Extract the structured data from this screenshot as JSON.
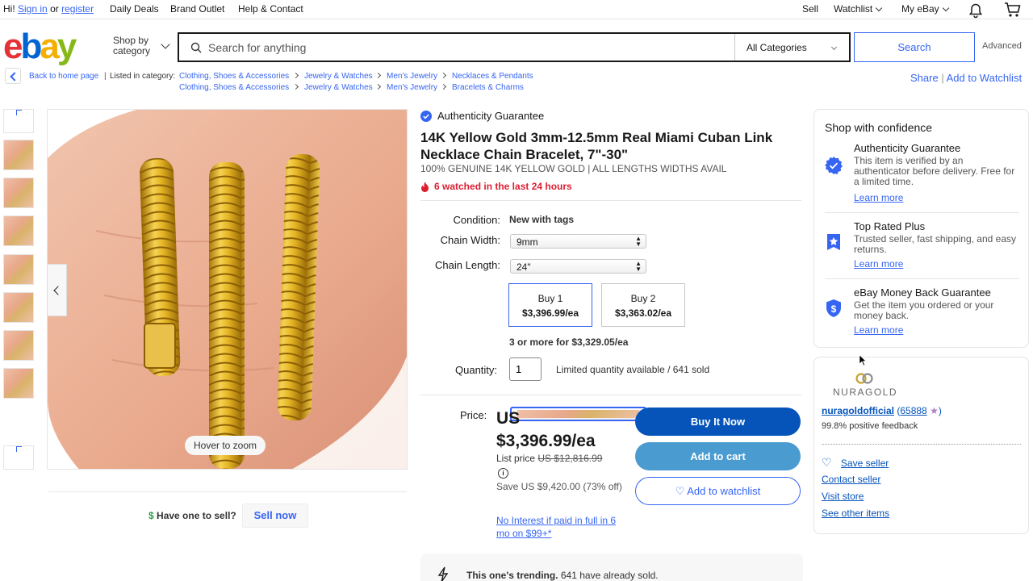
{
  "topbar": {
    "greeting": "Hi!",
    "signin": "Sign in",
    "or": "or",
    "register": "register",
    "daily_deals": "Daily Deals",
    "brand_outlet": "Brand Outlet",
    "help": "Help & Contact",
    "sell": "Sell",
    "watchlist": "Watchlist",
    "my_ebay": "My eBay",
    "bell_icon": "bell-icon",
    "cart_icon": "cart-icon"
  },
  "header": {
    "logo": [
      "e",
      "b",
      "a",
      "y"
    ],
    "shop_by_line1": "Shop by",
    "shop_by_line2": "category",
    "search_placeholder": "Search for anything",
    "category": "All Categories",
    "search_button": "Search",
    "advanced": "Advanced"
  },
  "breadcrumbs": {
    "back": "Back to home page",
    "listed_in": "Listed in category:",
    "row1": [
      "Clothing, Shoes & Accessories",
      "Jewelry & Watches",
      "Men's Jewelry",
      "Necklaces & Pendants"
    ],
    "row2": [
      "Clothing, Shoes & Accessories",
      "Jewelry & Watches",
      "Men's Jewelry",
      "Bracelets & Charms"
    ],
    "share": "Share",
    "add_to_watchlist": "Add to Watchlist"
  },
  "gallery": {
    "hover_to_zoom": "Hover to zoom",
    "thumb_count": 8,
    "selected_thumb": 8,
    "have_one": "Have one to sell?",
    "sell_now": "Sell now"
  },
  "listing": {
    "authenticity": "Authenticity Guarantee",
    "title": "14K Yellow Gold 3mm-12.5mm Real Miami Cuban Link Necklace Chain Bracelet, 7\"-30\"",
    "subtitle": "100% GENUINE 14K YELLOW GOLD | ALL LENGTHS WIDTHS AVAIL",
    "watched": "6 watched in the last 24 hours",
    "condition_label": "Condition:",
    "condition_value": "New with tags",
    "width_label": "Chain Width:",
    "width_value": "9mm",
    "length_label": "Chain Length:",
    "length_value": "24\"",
    "buy1_label": "Buy 1",
    "buy1_price": "$3,396.99/ea",
    "buy2_label": "Buy 2",
    "buy2_price": "$3,363.02/ea",
    "bulk": "3 or more for $3,329.05/ea",
    "quantity_label": "Quantity:",
    "quantity_value": "1",
    "availability": "Limited quantity available / 641 sold",
    "price_label": "Price:",
    "price_line1": "US",
    "price_line2": "$3,396.99/ea",
    "list_price_label": "List price",
    "list_price_value": "US $12,816.99",
    "save": "Save US $9,420.00 (73% off)",
    "no_interest": "No Interest if paid in full in 6 mo on $99+*",
    "buy_now": "Buy It Now",
    "add_to_cart": "Add to cart",
    "add_to_watchlist": "Add to watchlist",
    "trending_bold": "This one's trending.",
    "trending_rest": "641 have already sold."
  },
  "confidence": {
    "title": "Shop with confidence",
    "items": [
      {
        "title": "Authenticity Guarantee",
        "desc": "This item is verified by an authenticator before delivery. Free for a limited time.",
        "link": "Learn more"
      },
      {
        "title": "Top Rated Plus",
        "desc": "Trusted seller, fast shipping, and easy returns.",
        "link": "Learn more"
      },
      {
        "title": "eBay Money Back Guarantee",
        "desc": "Get the item you ordered or your money back.",
        "link": "Learn more"
      }
    ]
  },
  "seller": {
    "logo_text": "NURAGOLD",
    "name": "nuragoldofficial",
    "score": "65888",
    "feedback": "99.8% positive feedback",
    "save_seller": "Save seller",
    "contact": "Contact seller",
    "visit": "Visit store",
    "other": "See other items"
  },
  "colors": {
    "accent": "#3665f3",
    "buy_now": "#0654ba",
    "add_cart": "#4a9bd0",
    "alert": "#dd1e31"
  }
}
